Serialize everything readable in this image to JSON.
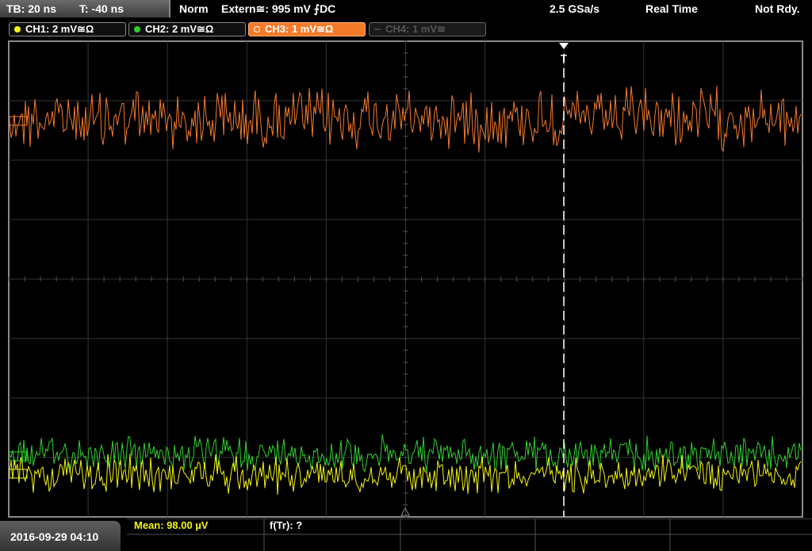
{
  "topbar": {
    "timebase": "TB: 20 ns",
    "trigger_time": "T: -40 ns",
    "mode": "Norm",
    "trigger": "Extern≅: 995 mV ⨍DC",
    "sample_rate": "2.5 GSa/s",
    "acquisition": "Real Time",
    "status": "Not Rdy."
  },
  "channels": [
    {
      "label": "CH1: 2 mV≅Ω",
      "color": "#f5f511",
      "active": true
    },
    {
      "label": "CH2: 2 mV≅Ω",
      "color": "#2fd12f",
      "active": true
    },
    {
      "label": "CH3: 1 mV≅Ω",
      "color": "#f47a2a",
      "active": true,
      "selected": true
    },
    {
      "label": "CH4: 1 mV≅",
      "color": "#555555",
      "active": false
    }
  ],
  "trigger_marker": "T",
  "measurements": {
    "mean": "Mean: 98.00 µV",
    "freq": "f(Tr): ?"
  },
  "datetime": "2016-09-29 04:10",
  "colors": {
    "ch1": "#f5f511",
    "ch2": "#2fd12f",
    "ch3": "#f47a2a",
    "grid": "#3a3a3a",
    "meas_text": "#f5f511"
  }
}
